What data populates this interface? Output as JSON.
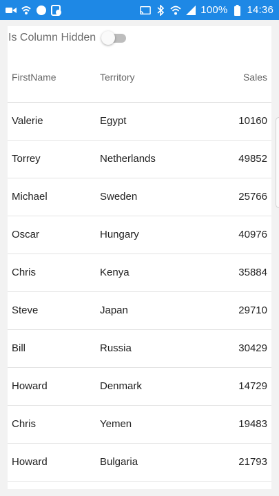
{
  "status_bar": {
    "battery_text": "100%",
    "time": "14:36",
    "left_icons": [
      "video-camera-icon",
      "wifi-call-icon",
      "circle-icon",
      "sync-icon"
    ],
    "right_icons": [
      "cast-icon",
      "bluetooth-icon",
      "wifi-icon",
      "signal-icon",
      "battery-icon"
    ],
    "color": "#1e88e5"
  },
  "toggle": {
    "label": "Is Column Hidden",
    "checked": false
  },
  "grid": {
    "columns": [
      "FirstName",
      "Territory",
      "Sales"
    ],
    "rows": [
      [
        "Valerie",
        "Egypt",
        "10160"
      ],
      [
        "Torrey",
        "Netherlands",
        "49852"
      ],
      [
        "Michael",
        "Sweden",
        "25766"
      ],
      [
        "Oscar",
        "Hungary",
        "40976"
      ],
      [
        "Chris",
        "Kenya",
        "35884"
      ],
      [
        "Steve",
        "Japan",
        "29710"
      ],
      [
        "Bill",
        "Russia",
        "30429"
      ],
      [
        "Howard",
        "Denmark",
        "14729"
      ],
      [
        "Chris",
        "Yemen",
        "19483"
      ],
      [
        "Howard",
        "Bulgaria",
        "21793"
      ]
    ]
  }
}
